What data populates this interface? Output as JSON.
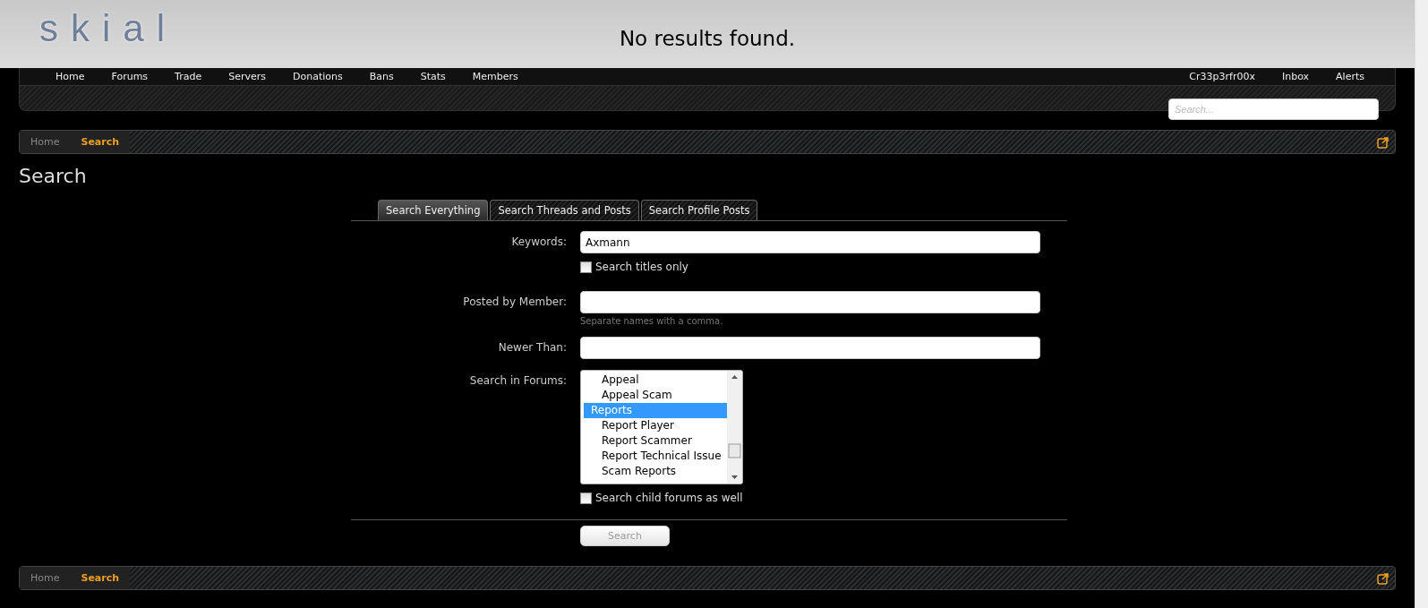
{
  "overlay": {
    "message": "No results found."
  },
  "header": {
    "logo": "skial",
    "nav": [
      "Home",
      "Forums",
      "Trade",
      "Servers",
      "Donations",
      "Bans",
      "Stats",
      "Members"
    ],
    "user_nav": [
      "Cr33p3rfr00x",
      "Inbox",
      "Alerts"
    ],
    "search": {
      "placeholder": "Search..."
    }
  },
  "breadcrumb_top": [
    {
      "label": "Home",
      "selected": false
    },
    {
      "label": "Search",
      "selected": true
    }
  ],
  "title": "Search",
  "tabs": [
    {
      "label": "Search Everything",
      "selected": true
    },
    {
      "label": "Search Threads and Posts",
      "selected": false
    },
    {
      "label": "Search Profile Posts",
      "selected": false
    }
  ],
  "form": {
    "keywords": {
      "label": "Keywords:",
      "value": "Axmann"
    },
    "titles_only": {
      "label": "Search titles only",
      "checked": false
    },
    "member": {
      "label": "Posted by Member:",
      "hint": "Separate names with a comma."
    },
    "newer": {
      "label": "Newer Than:"
    },
    "forums": {
      "label": "Search in Forums:",
      "items": [
        {
          "children": [
            {
              "label": "Appeal",
              "selected": false
            },
            {
              "label": "Appeal Scam",
              "selected": false
            }
          ]
        },
        {
          "label": "Reports",
          "selected": true,
          "children": [
            {
              "label": "Report Player",
              "selected": false
            },
            {
              "label": "Report Scammer",
              "selected": false
            },
            {
              "label": "Report Technical Issue",
              "selected": false
            },
            {
              "label": "Scam Reports",
              "selected": false
            }
          ]
        }
      ]
    },
    "child_forums": {
      "label": "Search child forums as well",
      "checked": false
    },
    "submit": "Search"
  },
  "breadcrumb_bottom": [
    {
      "label": "Home",
      "selected": false
    },
    {
      "label": "Search",
      "selected": true
    }
  ]
}
